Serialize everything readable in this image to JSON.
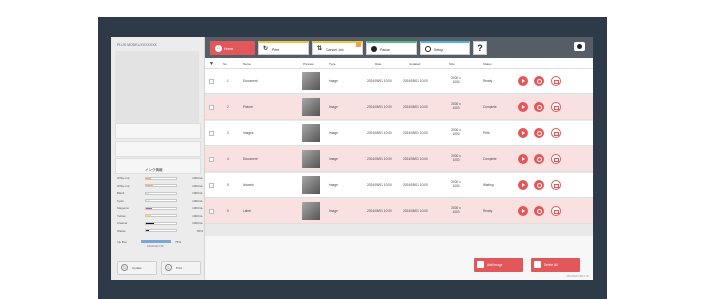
{
  "left_panel": {
    "model_label": "PLUS MODEL/XXXXXXX",
    "ink_title": "インク情報",
    "ink_levels": [
      {
        "name": "White Ink",
        "level": 0.15,
        "color": "#f2b36a",
        "volume": "1000mL"
      },
      {
        "name": "White Ink",
        "level": 0.22,
        "color": "#f2b36a",
        "volume": "1000mL"
      },
      {
        "name": "Black",
        "level": 0.1,
        "color": "#cfe5f4",
        "volume": "1000mL"
      },
      {
        "name": "Cyan",
        "level": 0.12,
        "color": "#d7ecf7",
        "volume": "1000mL"
      },
      {
        "name": "Magenta",
        "level": 0.2,
        "color": "#d44ca6",
        "volume": "1000mL"
      },
      {
        "name": "Yellow",
        "level": 0.15,
        "color": "#f5e54a",
        "volume": "1000mL"
      },
      {
        "name": "Cleaner",
        "level": 0.28,
        "color": "#111111",
        "volume": "1000mL"
      },
      {
        "name": "Waste",
        "level": 0.1,
        "color": "#333333",
        "volume": "50%"
      }
    ],
    "ink_bottom": {
      "label": "Ink Box",
      "value": "75%",
      "sub": "DAMAGE 0 B8"
    },
    "left_buttons": [
      {
        "label": "Update"
      },
      {
        "label": "Print"
      }
    ]
  },
  "toolbar": {
    "tabs": [
      {
        "label": "Home"
      },
      {
        "label": "Print"
      },
      {
        "label": "Cancel Job"
      },
      {
        "label": "Pause"
      },
      {
        "label": "Setup"
      }
    ],
    "help_label": "?"
  },
  "table": {
    "columns": [
      "No.",
      "Name",
      "Preview",
      "Type",
      "Date",
      "Updated",
      "Size",
      "Status"
    ],
    "rows": [
      {
        "num": "1",
        "name": "Document",
        "type": "Image",
        "d1": "2024/05/01 10:00",
        "d2": "2024/05/01 10:00",
        "size1": "2000 x",
        "size2": "1000",
        "status": "Ready"
      },
      {
        "num": "2",
        "name": "Picture",
        "type": "Image",
        "d1": "2024/05/01 10:00",
        "d2": "2024/05/01 10:00",
        "size1": "2000 x",
        "size2": "1000",
        "status": "Complete"
      },
      {
        "num": "3",
        "name": "Images",
        "type": "Image",
        "d1": "2024/05/01 10:00",
        "d2": "2024/05/01 10:00",
        "size1": "2000 x",
        "size2": "1000",
        "status": "Print"
      },
      {
        "num": "4",
        "name": "Document",
        "type": "Image",
        "d1": "2024/05/01 10:00",
        "d2": "2024/05/01 10:00",
        "size1": "2000 x",
        "size2": "1000",
        "status": "Complete"
      },
      {
        "num": "5",
        "name": "Artwork",
        "type": "Image",
        "d1": "2024/05/01 10:00",
        "d2": "2024/05/01 10:00",
        "size1": "2000 x",
        "size2": "1000",
        "status": "Waiting"
      },
      {
        "num": "6",
        "name": "Label",
        "type": "Image",
        "d1": "2024/05/01 10:00",
        "d2": "2024/05/01 10:00",
        "size1": "2000 x",
        "size2": "1000",
        "status": "Ready"
      }
    ]
  },
  "bottom_buttons": [
    {
      "label": "Add Image"
    },
    {
      "label": "Delete All"
    }
  ],
  "footer": "PRINTER VER 1.00"
}
